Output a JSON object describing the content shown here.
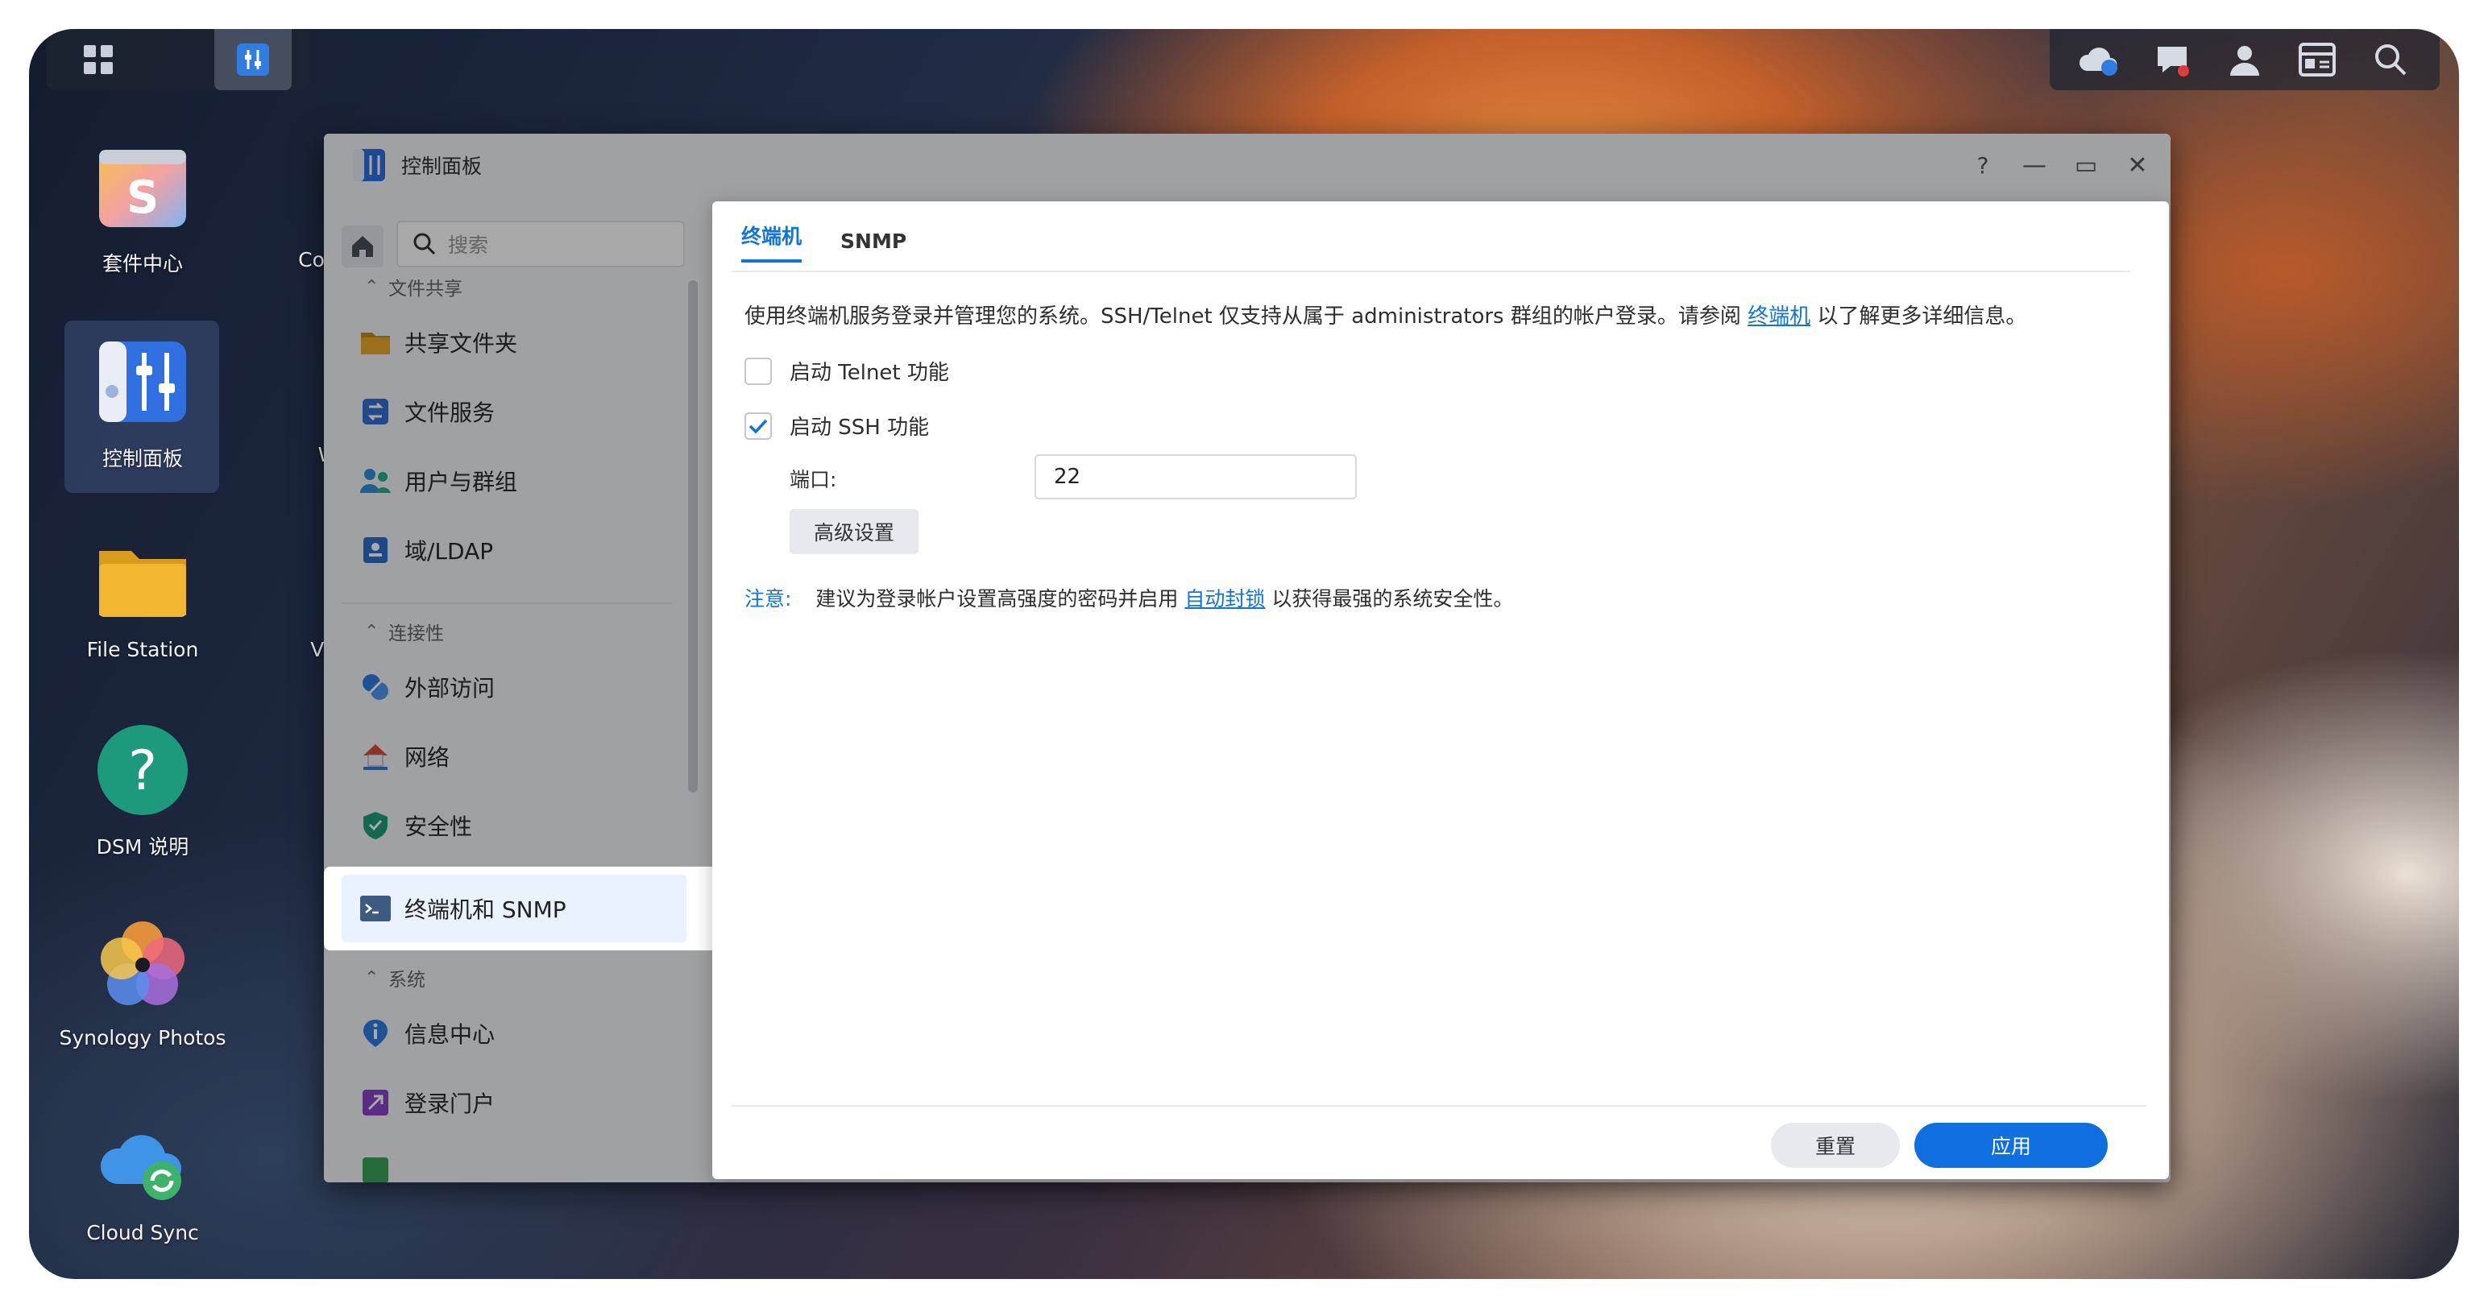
{
  "desktop": {
    "icons": [
      {
        "label": "套件中心"
      },
      {
        "label": "控制面板"
      },
      {
        "label": "File Station"
      },
      {
        "label": "DSM 说明"
      },
      {
        "label": "Synology Photos"
      },
      {
        "label": "Cloud Sync"
      }
    ],
    "partial_icons": [
      {
        "label": "Conta"
      },
      {
        "label": "W"
      },
      {
        "label": "Virt"
      }
    ]
  },
  "window": {
    "title": "控制面板",
    "help_glyph": "?",
    "minimize_glyph": "—",
    "maximize_glyph": "▭",
    "close_glyph": "✕"
  },
  "sidebar": {
    "search_placeholder": "搜索",
    "sections": [
      {
        "label": "文件共享",
        "items": [
          {
            "label": "共享文件夹",
            "icon": "folder-icon"
          },
          {
            "label": "文件服务",
            "icon": "file-services-icon"
          },
          {
            "label": "用户与群组",
            "icon": "users-icon"
          },
          {
            "label": "域/LDAP",
            "icon": "domain-icon"
          }
        ]
      },
      {
        "label": "连接性",
        "items": [
          {
            "label": "外部访问",
            "icon": "external-access-icon"
          },
          {
            "label": "网络",
            "icon": "network-icon"
          },
          {
            "label": "安全性",
            "icon": "shield-icon"
          },
          {
            "label": "终端机和 SNMP",
            "icon": "terminal-icon",
            "active": true
          }
        ]
      },
      {
        "label": "系统",
        "items": [
          {
            "label": "信息中心",
            "icon": "info-icon"
          },
          {
            "label": "登录门户",
            "icon": "login-portal-icon"
          }
        ]
      }
    ]
  },
  "dialog": {
    "tabs": [
      {
        "label": "终端机",
        "active": true
      },
      {
        "label": "SNMP",
        "active": false
      }
    ],
    "description_pre": "使用终端机服务登录并管理您的系统。SSH/Telnet 仅支持从属于 administrators 群组的帐户登录。请参阅",
    "description_link": "终端机",
    "description_post": "以了解更多详细信息。",
    "telnet": {
      "label": "启动 Telnet 功能",
      "checked": false
    },
    "ssh": {
      "label": "启动 SSH 功能",
      "checked": true
    },
    "port": {
      "label": "端口:",
      "value": "22"
    },
    "advanced_button": "高级设置",
    "note_label": "注意:",
    "note_pre": "建议为登录帐户设置高强度的密码并启用",
    "note_link": "自动封锁",
    "note_post": "以获得最强的系统安全性。",
    "reset_button": "重置",
    "apply_button": "应用"
  },
  "colors": {
    "accent": "#1274d8",
    "apply": "#0f6fde"
  }
}
